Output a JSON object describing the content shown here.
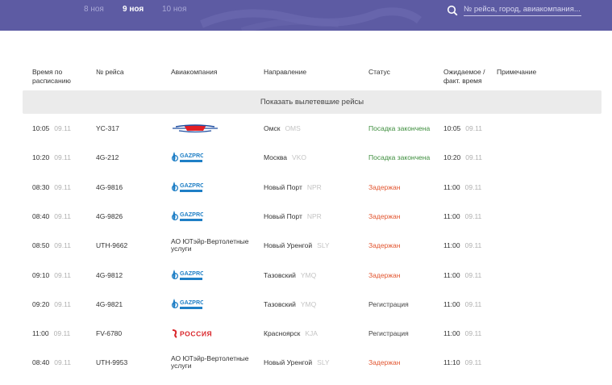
{
  "header": {
    "dates": [
      "8 ноя",
      "9 ноя",
      "10 ноя"
    ],
    "active_date": "9 ноя",
    "search_placeholder": "№ рейса, город, авиакомпания...",
    "search_value": ""
  },
  "colors": {
    "header_bg": "#5d5ba3",
    "status_green": "#3e8e3e",
    "status_red": "#e2552f",
    "muted": "#b0b0b0",
    "gazprom_blue": "#1f7fc6",
    "rossiya_red": "#d9252a",
    "utair_red": "#e31e24"
  },
  "table": {
    "headers": {
      "time_line1": "Время по",
      "time_line2": "расписанию",
      "flight": "№ рейса",
      "airline": "Авиакомпания",
      "direction": "Направление",
      "status": "Статус",
      "expected_line1": "Ожидаемое /",
      "expected_line2": "факт. время",
      "note": "Примечание"
    },
    "show_departed_label": "Показать вылетевшие рейсы",
    "rows": [
      {
        "time": "10:05",
        "date": "09.11",
        "flight": "YC-317",
        "airline_logo": "utair-logo",
        "airline_text": "",
        "city": "Омск",
        "code": "OMS",
        "status": "Посадка закончена",
        "status_type": "green",
        "exp_time": "10:05",
        "exp_date": "09.11"
      },
      {
        "time": "10:20",
        "date": "09.11",
        "flight": "4G-212",
        "airline_logo": "gazprom-logo",
        "airline_text": "",
        "city": "Москва",
        "code": "VKO",
        "status": "Посадка закончена",
        "status_type": "green",
        "exp_time": "10:20",
        "exp_date": "09.11"
      },
      {
        "time": "08:30",
        "date": "09.11",
        "flight": "4G-9816",
        "airline_logo": "gazprom-logo",
        "airline_text": "",
        "city": "Новый Порт",
        "code": "NPR",
        "status": "Задержан",
        "status_type": "red",
        "exp_time": "11:00",
        "exp_date": "09.11"
      },
      {
        "time": "08:40",
        "date": "09.11",
        "flight": "4G-9826",
        "airline_logo": "gazprom-logo",
        "airline_text": "",
        "city": "Новый Порт",
        "code": "NPR",
        "status": "Задержан",
        "status_type": "red",
        "exp_time": "11:00",
        "exp_date": "09.11"
      },
      {
        "time": "08:50",
        "date": "09.11",
        "flight": "UTH-9662",
        "airline_logo": "",
        "airline_text": "АО ЮТэйр-Вертолетные услуги",
        "city": "Новый Уренгой",
        "code": "SLY",
        "status": "Задержан",
        "status_type": "red",
        "exp_time": "11:00",
        "exp_date": "09.11"
      },
      {
        "time": "09:10",
        "date": "09.11",
        "flight": "4G-9812",
        "airline_logo": "gazprom-logo",
        "airline_text": "",
        "city": "Тазовский",
        "code": "YMQ",
        "status": "Задержан",
        "status_type": "red",
        "exp_time": "11:00",
        "exp_date": "09.11"
      },
      {
        "time": "09:20",
        "date": "09.11",
        "flight": "4G-9821",
        "airline_logo": "gazprom-logo",
        "airline_text": "",
        "city": "Тазовский",
        "code": "YMQ",
        "status": "Регистрация",
        "status_type": "gray",
        "exp_time": "11:00",
        "exp_date": "09.11"
      },
      {
        "time": "11:00",
        "date": "09.11",
        "flight": "FV-6780",
        "airline_logo": "rossiya-logo",
        "airline_text": "",
        "city": "Красноярск",
        "code": "KJA",
        "status": "Регистрация",
        "status_type": "gray",
        "exp_time": "11:00",
        "exp_date": "09.11"
      },
      {
        "time": "08:40",
        "date": "09.11",
        "flight": "UTH-9953",
        "airline_logo": "",
        "airline_text": "АО ЮТэйр-Вертолетные услуги",
        "city": "Новый Уренгой",
        "code": "SLY",
        "status": "Задержан",
        "status_type": "red",
        "exp_time": "11:10",
        "exp_date": "09.11"
      }
    ],
    "logo_text": {
      "gazprom": "GAZPROM",
      "rossiya": "РОССИЯ"
    }
  }
}
